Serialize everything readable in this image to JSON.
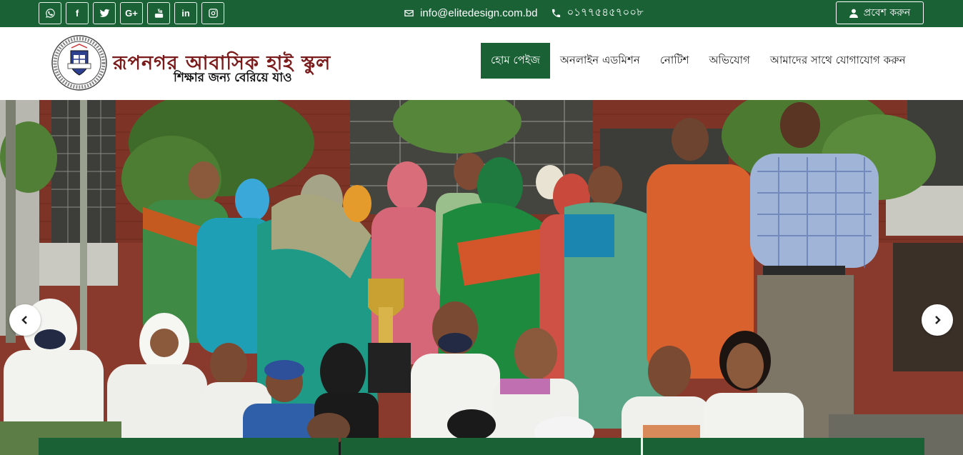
{
  "topbar": {
    "social": [
      {
        "name": "whatsapp-icon",
        "glyph": ""
      },
      {
        "name": "facebook-icon",
        "glyph": "f"
      },
      {
        "name": "twitter-icon",
        "glyph": ""
      },
      {
        "name": "google-plus-icon",
        "glyph": "G+"
      },
      {
        "name": "youtube-icon",
        "glyph": ""
      },
      {
        "name": "linkedin-icon",
        "glyph": "in"
      },
      {
        "name": "instagram-icon",
        "glyph": ""
      }
    ],
    "email": "info@elitedesign.com.bd",
    "phone": "০১৭৭৫৪৫৭০০৮",
    "login_label": "প্রবেশ করুন"
  },
  "header": {
    "school_name": "রূপনগর আবাসিক হাই স্কুল",
    "tagline": "শিক্ষার জন্য বেরিয়ে যাও",
    "nav": [
      {
        "label": "হোম পেইজ",
        "active": true
      },
      {
        "label": "অনলাইন এডমিশন",
        "active": false
      },
      {
        "label": "নোটিশ",
        "active": false
      },
      {
        "label": "অভিযোগ",
        "active": false
      },
      {
        "label": "আমাদের সাথে যোগাযোগ করুন",
        "active": false
      }
    ]
  },
  "colors": {
    "brand_green": "#1a6136",
    "school_name_red": "#7a1a1a"
  }
}
